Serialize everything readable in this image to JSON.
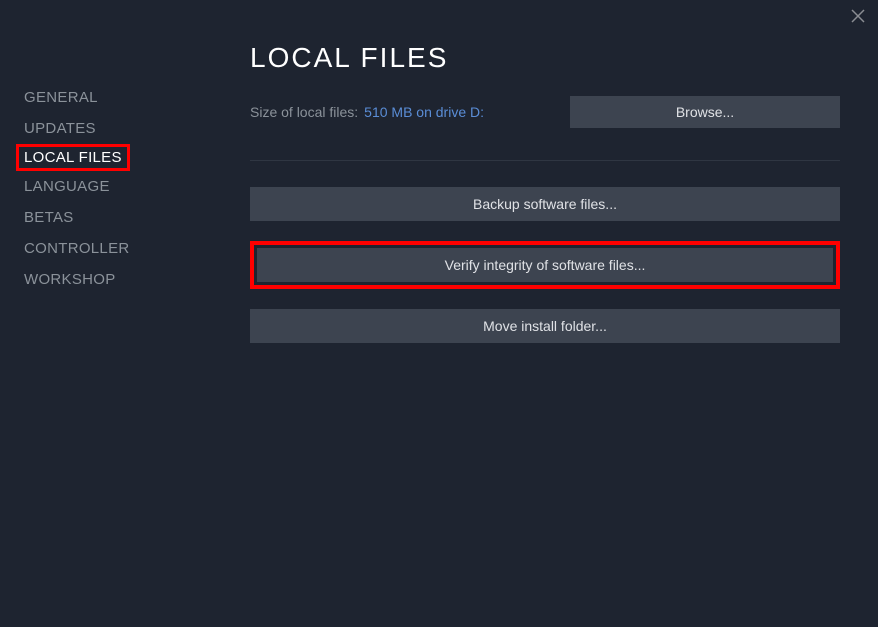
{
  "sidebar": {
    "items": [
      {
        "label": "GENERAL"
      },
      {
        "label": "UPDATES"
      },
      {
        "label": "LOCAL FILES",
        "active": true,
        "highlighted": true
      },
      {
        "label": "LANGUAGE"
      },
      {
        "label": "BETAS"
      },
      {
        "label": "CONTROLLER"
      },
      {
        "label": "WORKSHOP"
      }
    ]
  },
  "main": {
    "title": "LOCAL FILES",
    "size_label": "Size of local files:",
    "size_value": "510 MB on drive D:",
    "browse_label": "Browse...",
    "buttons": {
      "backup": "Backup software files...",
      "verify": "Verify integrity of software files...",
      "move": "Move install folder..."
    }
  }
}
